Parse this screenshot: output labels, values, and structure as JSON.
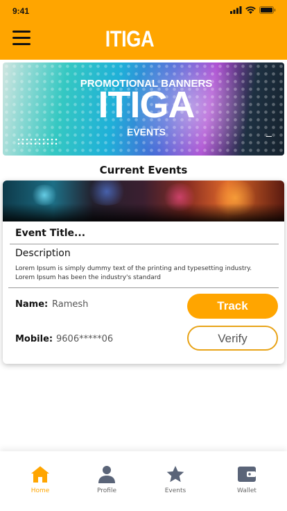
{
  "status_bar": {
    "time": "9:41"
  },
  "header": {
    "title": "ITIGA",
    "menu_icon": "hamburger-icon"
  },
  "banner": {
    "line1": "PROMOTIONAL BANNERS",
    "line2": "ITIGA",
    "line3": "EVENTS"
  },
  "section_title": "Current Events",
  "event_card": {
    "title": "Event Title...",
    "description_label": "Description",
    "description_line1": "Lorem Ipsum is simply dummy text of the printing and typesetting industry.",
    "description_line2": "Lorem Ipsum has been the industry's standard",
    "name_label": "Name:",
    "name_value": "Ramesh",
    "mobile_label": "Mobile:",
    "mobile_value": "9606*****06",
    "track_label": "Track",
    "verify_label": "Verify"
  },
  "bottom_nav": {
    "items": [
      {
        "label": "Home",
        "icon": "home-icon",
        "active": true
      },
      {
        "label": "Profile",
        "icon": "user-icon",
        "active": false
      },
      {
        "label": "Events",
        "icon": "star-icon",
        "active": false
      },
      {
        "label": "Wallet",
        "icon": "wallet-icon",
        "active": false
      }
    ]
  },
  "colors": {
    "accent": "#FFA500",
    "inactive_icon": "#5A6478",
    "verify_border": "#E8A317"
  }
}
